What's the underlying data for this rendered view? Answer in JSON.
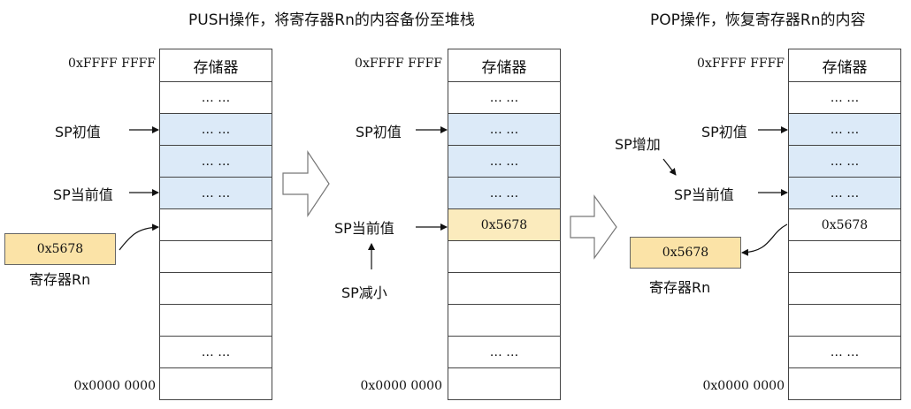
{
  "titles": {
    "push": "PUSH操作，将寄存器Rn的内容备份至堆栈",
    "pop": "POP操作，恢复寄存器Rn的内容"
  },
  "addresses": {
    "high": "0xFFFF FFFF",
    "low": "0x0000 0000"
  },
  "memory_header": "存储器",
  "ellipsis": "… …",
  "value": "0x5678",
  "labels": {
    "sp_initial": "SP初值",
    "sp_current": "SP当前值",
    "sp_decrease": "SP减小",
    "sp_increase": "SP增加",
    "register": "寄存器Rn"
  },
  "colors": {
    "stack_fill": "#dceaf8",
    "value_fill": "#fbebbd",
    "register_fill": "#fbe3a7"
  }
}
